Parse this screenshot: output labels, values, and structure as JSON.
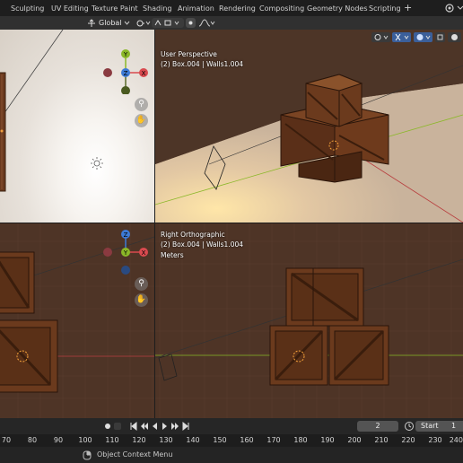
{
  "workspace_tabs": [
    "Sculpting",
    "UV Editing",
    "Texture Paint",
    "Shading",
    "Animation",
    "Rendering",
    "Compositing",
    "Geometry Nodes",
    "Scripting"
  ],
  "header": {
    "transform_orientation": "Global"
  },
  "viewport_top_right": {
    "title": "User Perspective",
    "subtitle": "(2) Box.004 | Walls1.004"
  },
  "viewport_bottom_right": {
    "title": "Right Orthographic",
    "subtitle": "(2) Box.004 | Walls1.004",
    "units": "Meters"
  },
  "gizmo": {
    "x": "X",
    "y": "Y",
    "z": "Z"
  },
  "timeline": {
    "current_frame": "2",
    "start_label": "Start",
    "start_value": "1"
  },
  "ruler_ticks": [
    "70",
    "80",
    "90",
    "100",
    "110",
    "120",
    "130",
    "140",
    "150",
    "160",
    "170",
    "180",
    "190",
    "200",
    "210",
    "220",
    "230",
    "240"
  ],
  "status": {
    "context_menu": "Object Context Menu"
  },
  "colors": {
    "x_axis": "#d94a4f",
    "y_axis": "#8bb828",
    "z_axis": "#3d7bd6",
    "selection": "#f5a23a"
  }
}
